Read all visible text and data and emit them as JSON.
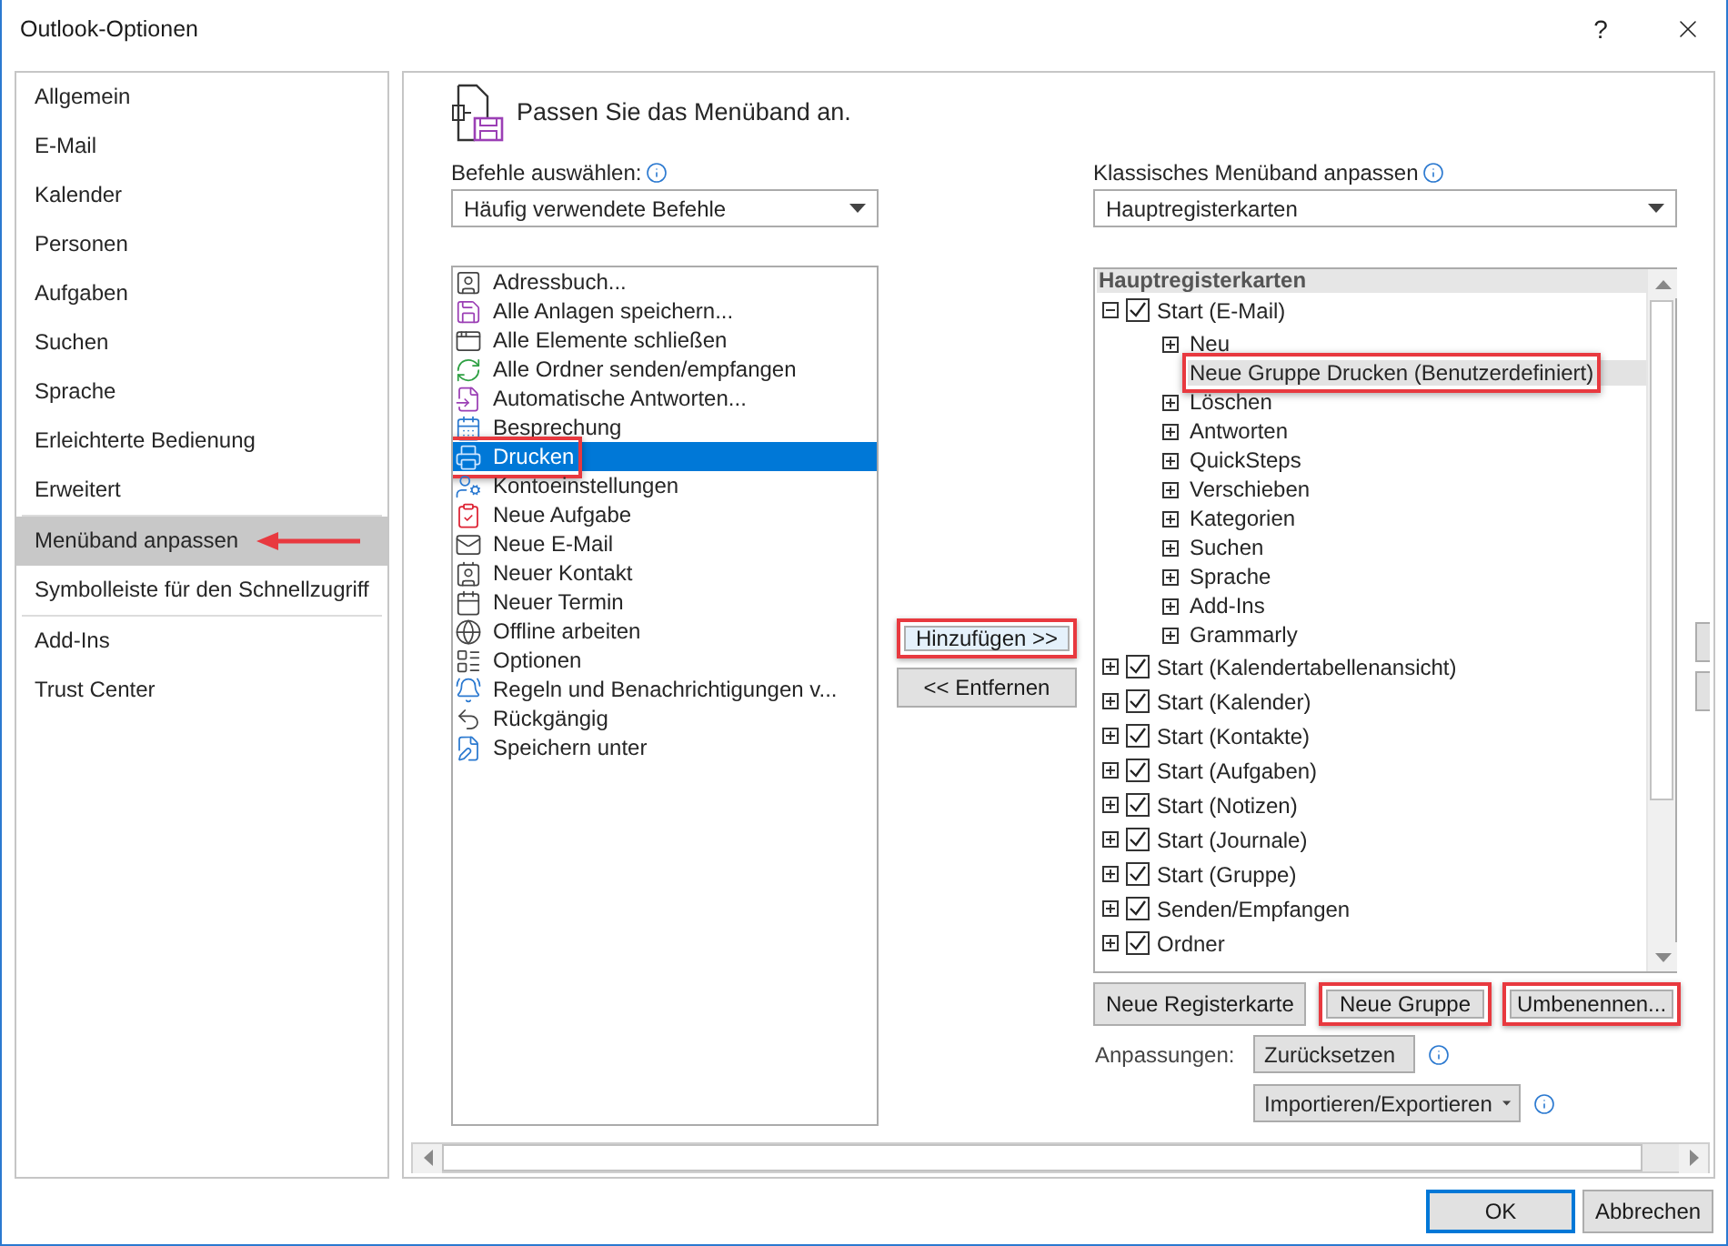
{
  "window": {
    "title": "Outlook-Optionen",
    "help": "?"
  },
  "sidebar": {
    "groups": [
      {
        "items": [
          {
            "label": "Allgemein",
            "selected": false,
            "annotated": false
          },
          {
            "label": "E-Mail",
            "selected": false,
            "annotated": false
          },
          {
            "label": "Kalender",
            "selected": false,
            "annotated": false
          },
          {
            "label": "Personen",
            "selected": false,
            "annotated": false
          },
          {
            "label": "Aufgaben",
            "selected": false,
            "annotated": false
          },
          {
            "label": "Suchen",
            "selected": false,
            "annotated": false
          },
          {
            "label": "Sprache",
            "selected": false,
            "annotated": false
          },
          {
            "label": "Erleichterte Bedienung",
            "selected": false,
            "annotated": false
          },
          {
            "label": "Erweitert",
            "selected": false,
            "annotated": false
          }
        ]
      },
      {
        "items": [
          {
            "label": "Menüband anpassen",
            "selected": true,
            "annotated": true
          },
          {
            "label": "Symbolleiste für den Schnellzugriff",
            "selected": false,
            "annotated": false
          }
        ]
      },
      {
        "items": [
          {
            "label": "Add-Ins",
            "selected": false,
            "annotated": false
          },
          {
            "label": "Trust Center",
            "selected": false,
            "annotated": false
          }
        ]
      }
    ]
  },
  "heading": "Passen Sie das Menüband an.",
  "commands": {
    "label": "Befehle auswählen:",
    "dropdown": "Häufig verwendete Befehle",
    "items": [
      {
        "label": "Adressbuch...",
        "selected": false,
        "annotated": false
      },
      {
        "label": "Alle Anlagen speichern...",
        "selected": false,
        "annotated": false
      },
      {
        "label": "Alle Elemente schließen",
        "selected": false,
        "annotated": false
      },
      {
        "label": "Alle Ordner senden/empfangen",
        "selected": false,
        "annotated": false
      },
      {
        "label": "Automatische Antworten...",
        "selected": false,
        "annotated": false
      },
      {
        "label": "Besprechung",
        "selected": false,
        "annotated": false
      },
      {
        "label": "Drucken",
        "selected": true,
        "annotated": true
      },
      {
        "label": "Kontoeinstellungen",
        "selected": false,
        "annotated": false
      },
      {
        "label": "Neue Aufgabe",
        "selected": false,
        "annotated": false
      },
      {
        "label": "Neue E-Mail",
        "selected": false,
        "annotated": false
      },
      {
        "label": "Neuer Kontakt",
        "selected": false,
        "annotated": false
      },
      {
        "label": "Neuer Termin",
        "selected": false,
        "annotated": false
      },
      {
        "label": "Offline arbeiten",
        "selected": false,
        "annotated": false
      },
      {
        "label": "Optionen",
        "selected": false,
        "annotated": false
      },
      {
        "label": "Regeln und Benachrichtigungen v...",
        "selected": false,
        "annotated": false
      },
      {
        "label": "Rückgängig",
        "selected": false,
        "annotated": false
      },
      {
        "label": "Speichern unter",
        "selected": false,
        "annotated": false
      }
    ]
  },
  "transfer": [
    {
      "label": "Hinzufügen >>",
      "annotated": true
    },
    {
      "label": "<< Entfernen",
      "annotated": false
    }
  ],
  "ribbon": {
    "label": "Klassisches Menüband anpassen",
    "dropdown": "Hauptregisterkarten",
    "tree_header": "Hauptregisterkarten",
    "tabs": [
      {
        "label": "Start (E-Mail)",
        "checked": true,
        "expanded": true,
        "children": [
          {
            "label": "Neu",
            "expandable": true,
            "selected": false,
            "annotated": false
          },
          {
            "label": "Neue Gruppe Drucken (Benutzerdefiniert)",
            "expandable": false,
            "selected": true,
            "annotated": true
          },
          {
            "label": "Löschen",
            "expandable": true,
            "selected": false,
            "annotated": false
          },
          {
            "label": "Antworten",
            "expandable": true,
            "selected": false,
            "annotated": false
          },
          {
            "label": "QuickSteps",
            "expandable": true,
            "selected": false,
            "annotated": false
          },
          {
            "label": "Verschieben",
            "expandable": true,
            "selected": false,
            "annotated": false
          },
          {
            "label": "Kategorien",
            "expandable": true,
            "selected": false,
            "annotated": false
          },
          {
            "label": "Suchen",
            "expandable": true,
            "selected": false,
            "annotated": false
          },
          {
            "label": "Sprache",
            "expandable": true,
            "selected": false,
            "annotated": false
          },
          {
            "label": "Add-Ins",
            "expandable": true,
            "selected": false,
            "annotated": false
          },
          {
            "label": "Grammarly",
            "expandable": true,
            "selected": false,
            "annotated": false
          }
        ]
      },
      {
        "label": "Start (Kalendertabellenansicht)",
        "checked": true,
        "expanded": false
      },
      {
        "label": "Start (Kalender)",
        "checked": true,
        "expanded": false
      },
      {
        "label": "Start (Kontakte)",
        "checked": true,
        "expanded": false
      },
      {
        "label": "Start (Aufgaben)",
        "checked": true,
        "expanded": false
      },
      {
        "label": "Start (Notizen)",
        "checked": true,
        "expanded": false
      },
      {
        "label": "Start (Journale)",
        "checked": true,
        "expanded": false
      },
      {
        "label": "Start (Gruppe)",
        "checked": true,
        "expanded": false
      },
      {
        "label": "Senden/Empfangen",
        "checked": true,
        "expanded": false
      },
      {
        "label": "Ordner",
        "checked": true,
        "expanded": false
      }
    ],
    "buttons": [
      {
        "label": "Neue Registerkarte",
        "annotated": false
      },
      {
        "label": "Neue Gruppe",
        "annotated": true
      },
      {
        "label": "Umbenennen...",
        "annotated": true
      }
    ]
  },
  "customizations": {
    "label": "Anpassungen:",
    "reset": "Zurücksetzen",
    "import_export": "Importieren/Exportieren"
  },
  "footer": [
    {
      "label": "OK",
      "default": true
    },
    {
      "label": "Abbrechen",
      "default": false
    }
  ]
}
